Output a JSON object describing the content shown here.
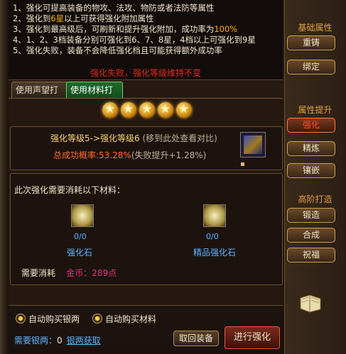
{
  "rules": [
    {
      "text": "1、强化可提高装备的物攻、法攻、物防或者法防等属性"
    },
    {
      "pre": "2、强化到",
      "hl": "6星",
      "post": "以上可获得强化附加属性"
    },
    {
      "pre": "3、强化到最高级后，可刷新和提升强化附加，成功率为",
      "hl": "100%",
      "post": ""
    },
    {
      "text": "4、1、2、3档装备分别可强化到6、7、8星，4档以上可强化到9星"
    },
    {
      "text": "5、强化失败，装备不会降低强化档且可能获得额外成功率"
    }
  ],
  "fail_notice": "强化失败，强化等级维持不变",
  "tabs": {
    "reputation": "使用声望打造",
    "material": "使用材料打造"
  },
  "stars": 5,
  "level": {
    "text": "强化等级5->强化等级6",
    "tip": "(移到此处查看对比)"
  },
  "rate": {
    "label": "总成功概率:",
    "value": "53.28%",
    "extra": "(失败提升+1.28%)"
  },
  "materials": {
    "title": "此次强化需要消耗以下材料：",
    "items": [
      {
        "name": "强化石",
        "count": "0/0"
      },
      {
        "name": "精品强化石",
        "count": "0/0"
      }
    ]
  },
  "cost": {
    "label": "需要消耗",
    "gold_label": "金币：",
    "gold_value": "289点"
  },
  "options": {
    "auto_silver": "自动购买银两",
    "auto_material": "自动购买材料"
  },
  "silver": {
    "label": "需要银两：",
    "value": "0",
    "link": "银两获取"
  },
  "buttons": {
    "recall": "取回装备",
    "go": "进行强化"
  },
  "sidebar": {
    "sections": [
      {
        "title": "基础属性",
        "items": [
          "重铸",
          "绑定"
        ]
      },
      {
        "title": "属性提升",
        "items": [
          "强化",
          "精炼",
          "镶嵌"
        ]
      },
      {
        "title": "高阶打造",
        "items": [
          "锻造",
          "合成",
          "祝福"
        ]
      }
    ],
    "active": "强化"
  }
}
